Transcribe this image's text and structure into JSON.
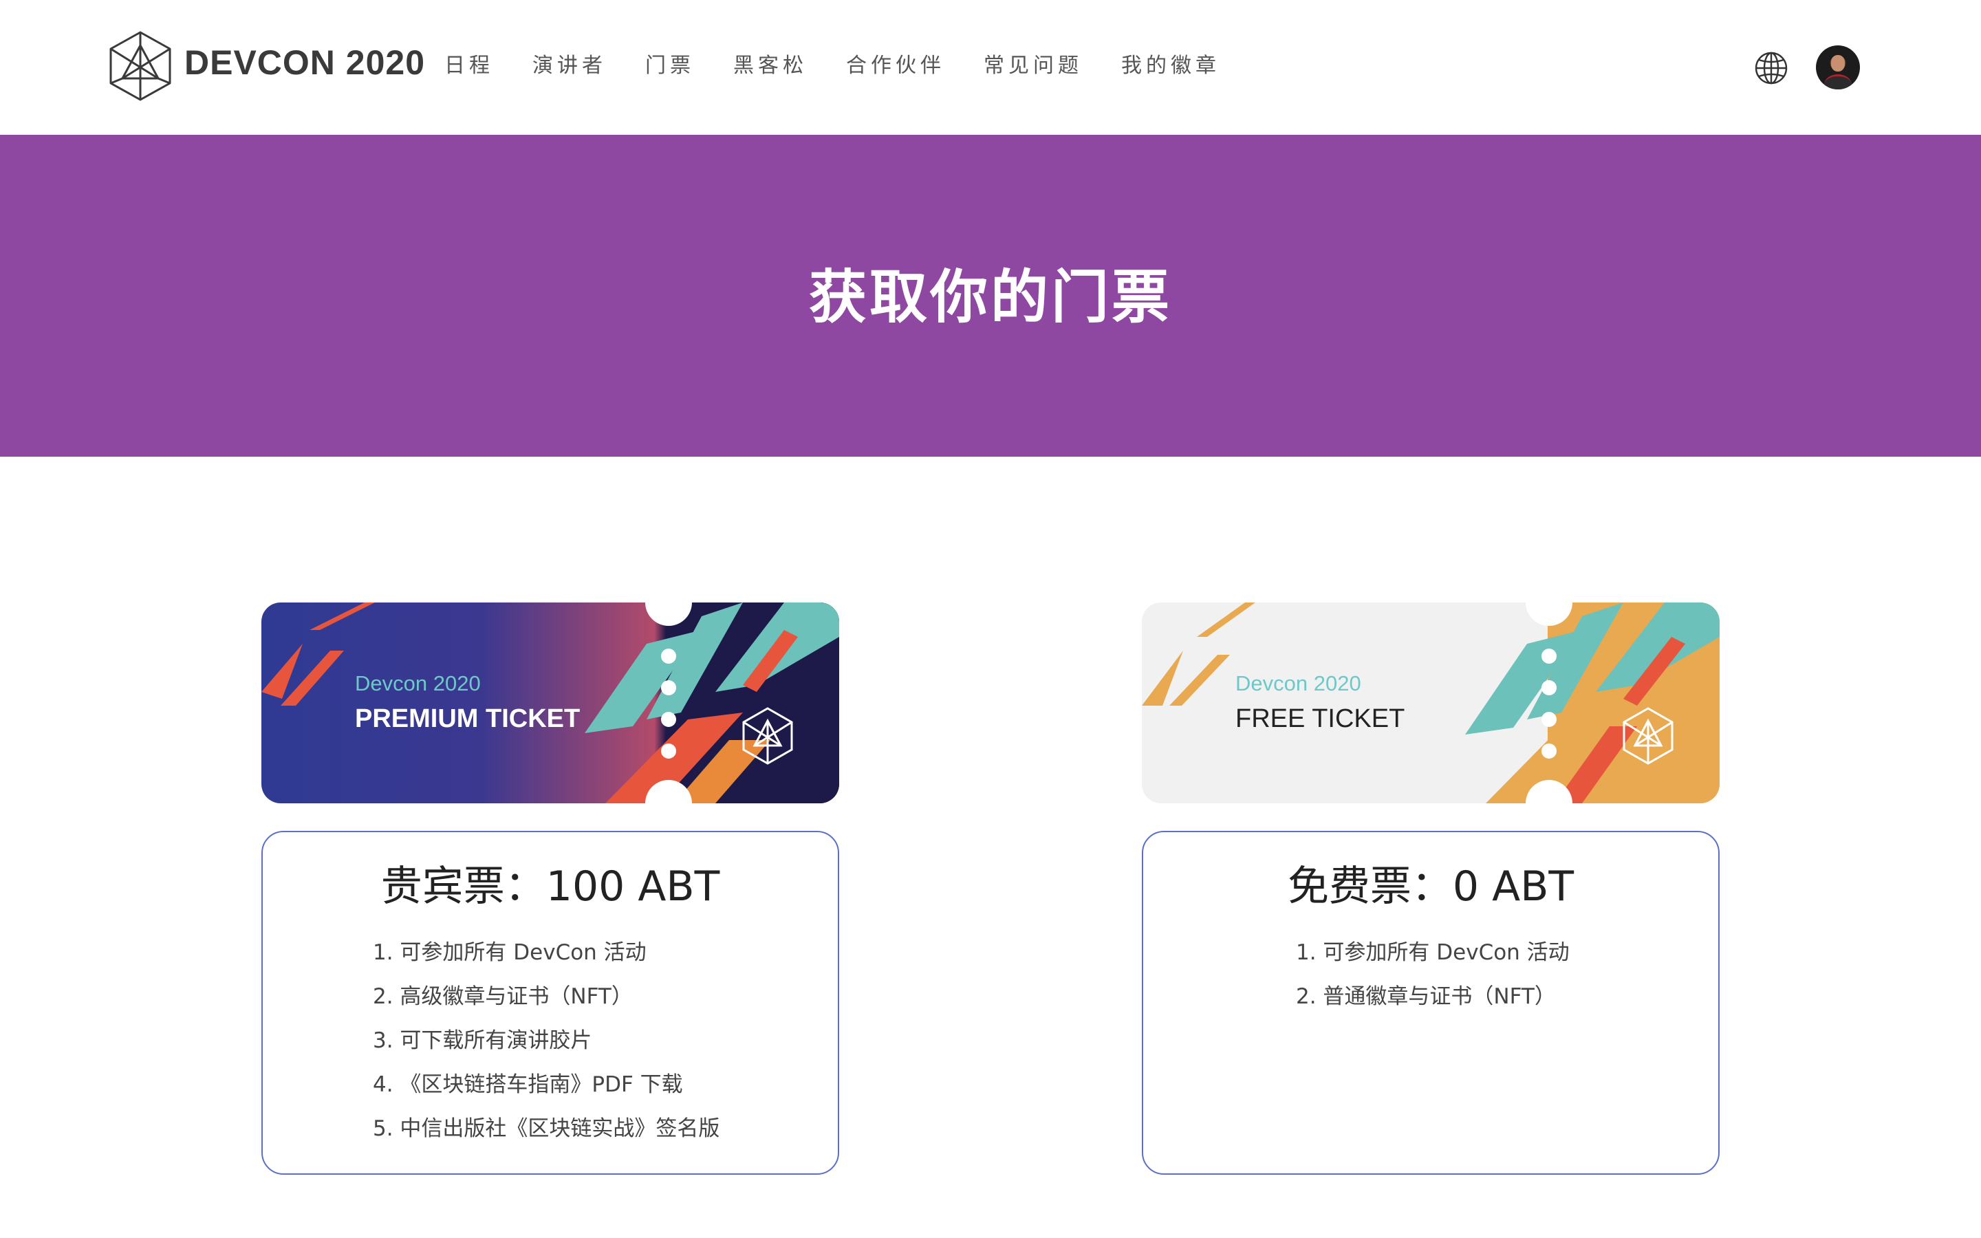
{
  "brand": {
    "name": "DEVCON 2020"
  },
  "nav": {
    "items": [
      "日程",
      "演讲者",
      "门票",
      "黑客松",
      "合作伙伴",
      "常见问题",
      "我的徽章"
    ]
  },
  "header_icons": {
    "language": "globe-icon",
    "user": "avatar"
  },
  "banner": {
    "title": "获取你的门票"
  },
  "tickets": [
    {
      "year_label": "Devcon 2020",
      "name": "PREMIUM TICKET",
      "price": "贵宾票：100 ABT",
      "benefits": [
        "1. 可参加所有 DevCon 活动",
        "2. 高级徽章与证书（NFT）",
        "3. 可下载所有演讲胶片",
        "4. 《区块链搭车指南》PDF 下载",
        "5. 中信出版社《区块链实战》签名版"
      ],
      "colors": {
        "left": "#2f3a93",
        "mid": "#b34b6a",
        "stub": "#1d1a4a",
        "accent1": "#e8553d",
        "accent2": "#6cc1bb"
      }
    },
    {
      "year_label": "Devcon 2020",
      "name": "FREE TICKET",
      "price": "免费票：0 ABT",
      "benefits": [
        "1. 可参加所有 DevCon 活动",
        "2. 普通徽章与证书（NFT）"
      ],
      "colors": {
        "left": "#f1f1f1",
        "stub": "#e8a950",
        "accent1": "#e8a950",
        "accent2": "#6cc1bb",
        "accent3": "#e8553d"
      }
    }
  ],
  "theme": {
    "banner": "#8f48a2",
    "card_border": "#5a6fc8"
  }
}
